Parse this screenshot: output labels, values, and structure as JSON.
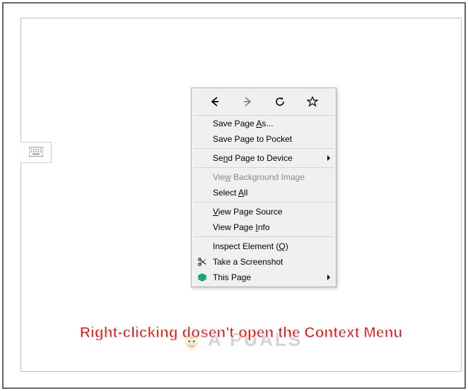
{
  "context_menu": {
    "save_as": "Save Page As...",
    "save_pocket": "Save Page to Pocket",
    "send_device": "Send Page to Device",
    "view_bg": "View Background Image",
    "select_all": "Select All",
    "view_source": "View Page Source",
    "view_info": "View Page Info",
    "inspect": "Inspect Element (Q)",
    "screenshot": "Take a Screenshot",
    "this_page": "This Page"
  },
  "watermark": {
    "text": "A  PUALS"
  },
  "caption": "Right-clicking dosen't open the Context Menu"
}
